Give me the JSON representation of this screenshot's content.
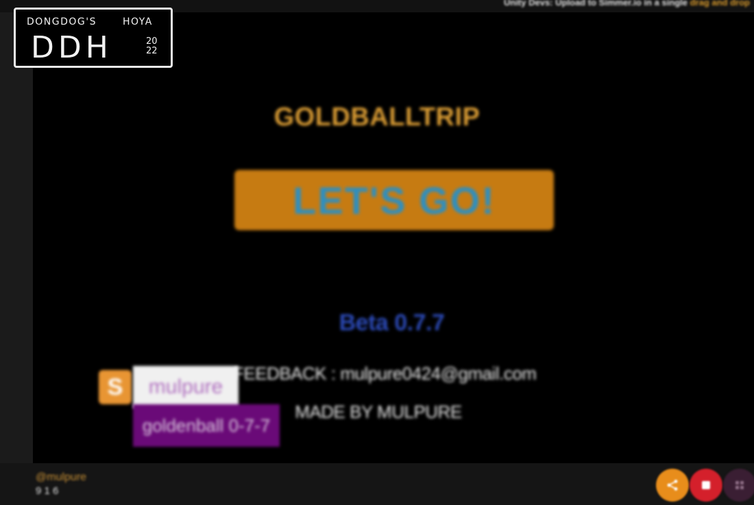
{
  "top_notice": {
    "text": "Unity Devs: Upload to ",
    "text_mid": "Simmer.io ",
    "text_end": "in a single ",
    "highlight": "drag and drop"
  },
  "watermark": {
    "line1": "DONGDOG'S",
    "line1b": "HOYA",
    "big": "DDH",
    "year_top": "20",
    "year_bottom": "22"
  },
  "game": {
    "title": "GOLDBALLTRIP",
    "play_label": "LET'S GO!",
    "version": "Beta 0.7.7",
    "feedback": "FEEDBACK : mulpure0424@gmail.com",
    "credit": "MADE BY MULPURE"
  },
  "badges": {
    "icon_letter": "S",
    "user": "mulpure",
    "build": "goldenball 0-7-7"
  },
  "bottom": {
    "author": "@mulpure",
    "plays": "9 1 6"
  },
  "colors": {
    "title": "#d79a33",
    "play_bg": "#c67b12",
    "play_text": "#2d8fc0",
    "version": "#2b49b5",
    "share": "#e88d1b",
    "stop": "#d4202b"
  },
  "icons": [
    "share-icon",
    "stop-icon",
    "grid-icon"
  ]
}
